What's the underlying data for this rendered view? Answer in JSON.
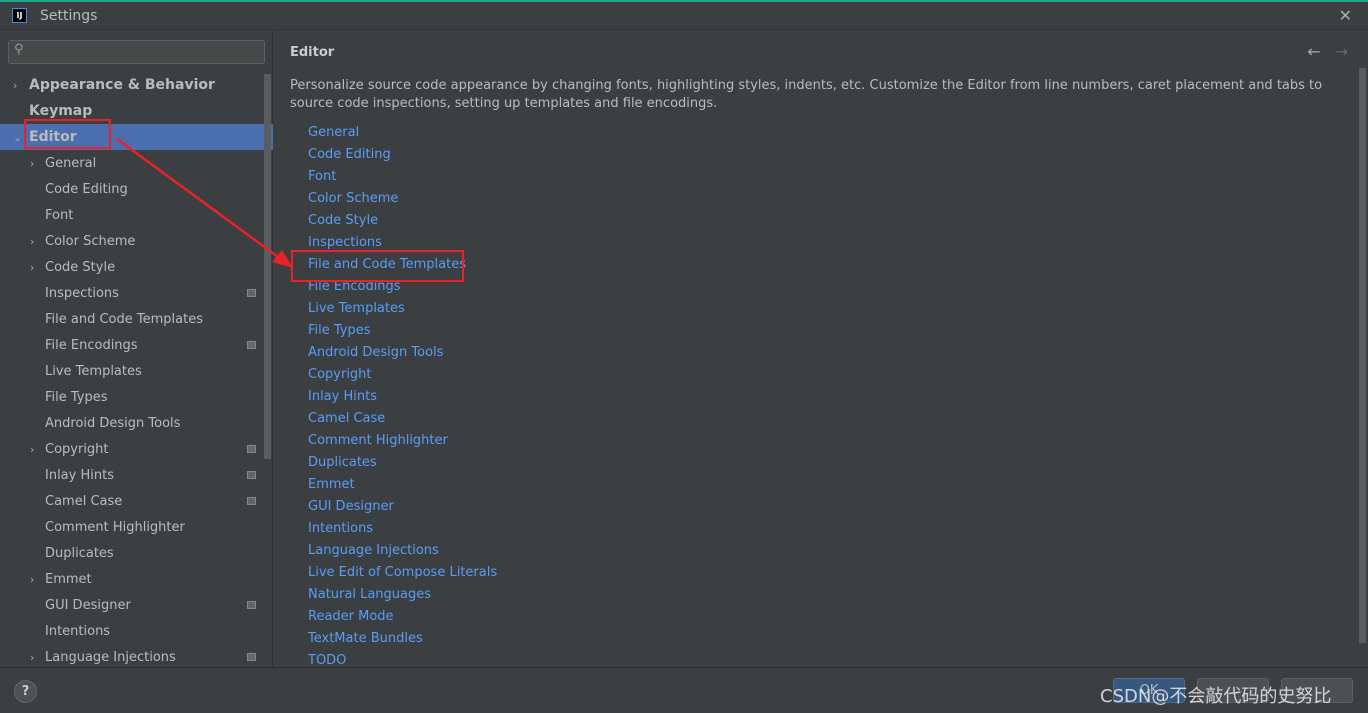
{
  "window": {
    "title": "Settings",
    "logo": "IJ"
  },
  "search": {
    "placeholder": "",
    "icon": "search-icon"
  },
  "tree": [
    {
      "label": "Appearance & Behavior",
      "level": 0,
      "arrow": "›",
      "project": false
    },
    {
      "label": "Keymap",
      "level": 0,
      "arrow": "",
      "project": false
    },
    {
      "label": "Editor",
      "level": 0,
      "arrow": "⌄",
      "project": false,
      "selected": true
    },
    {
      "label": "General",
      "level": 1,
      "arrow": "›",
      "project": false
    },
    {
      "label": "Code Editing",
      "level": 1,
      "arrow": "",
      "project": false
    },
    {
      "label": "Font",
      "level": 1,
      "arrow": "",
      "project": false
    },
    {
      "label": "Color Scheme",
      "level": 1,
      "arrow": "›",
      "project": false
    },
    {
      "label": "Code Style",
      "level": 1,
      "arrow": "›",
      "project": false
    },
    {
      "label": "Inspections",
      "level": 1,
      "arrow": "",
      "project": true
    },
    {
      "label": "File and Code Templates",
      "level": 1,
      "arrow": "",
      "project": false
    },
    {
      "label": "File Encodings",
      "level": 1,
      "arrow": "",
      "project": true
    },
    {
      "label": "Live Templates",
      "level": 1,
      "arrow": "",
      "project": false
    },
    {
      "label": "File Types",
      "level": 1,
      "arrow": "",
      "project": false
    },
    {
      "label": "Android Design Tools",
      "level": 1,
      "arrow": "",
      "project": false
    },
    {
      "label": "Copyright",
      "level": 1,
      "arrow": "›",
      "project": true
    },
    {
      "label": "Inlay Hints",
      "level": 1,
      "arrow": "",
      "project": true
    },
    {
      "label": "Camel Case",
      "level": 1,
      "arrow": "",
      "project": true
    },
    {
      "label": "Comment Highlighter",
      "level": 1,
      "arrow": "",
      "project": false
    },
    {
      "label": "Duplicates",
      "level": 1,
      "arrow": "",
      "project": false
    },
    {
      "label": "Emmet",
      "level": 1,
      "arrow": "›",
      "project": false
    },
    {
      "label": "GUI Designer",
      "level": 1,
      "arrow": "",
      "project": true
    },
    {
      "label": "Intentions",
      "level": 1,
      "arrow": "",
      "project": false
    },
    {
      "label": "Language Injections",
      "level": 1,
      "arrow": "›",
      "project": true
    }
  ],
  "main": {
    "heading": "Editor",
    "back": "←",
    "forward": "→",
    "description": "Personalize source code appearance by changing fonts, highlighting styles, indents, etc. Customize the Editor from line numbers, caret placement and tabs to source code inspections, setting up templates and file encodings.",
    "links": [
      "General",
      "Code Editing",
      "Font",
      "Color Scheme",
      "Code Style",
      "Inspections",
      "File and Code Templates",
      "File Encodings",
      "Live Templates",
      "File Types",
      "Android Design Tools",
      "Copyright",
      "Inlay Hints",
      "Camel Case",
      "Comment Highlighter",
      "Duplicates",
      "Emmet",
      "GUI Designer",
      "Intentions",
      "Language Injections",
      "Live Edit of Compose Literals",
      "Natural Languages",
      "Reader Mode",
      "TextMate Bundles",
      "TODO"
    ]
  },
  "footer": {
    "help": "?",
    "ok": "OK",
    "cancel": "",
    "apply": ""
  },
  "watermark": "CSDN @不会敲代码的史努比",
  "colors": {
    "link": "#589df6",
    "selection": "#4b6eaf",
    "annotation": "#e8212a",
    "background": "#3c3f41"
  }
}
